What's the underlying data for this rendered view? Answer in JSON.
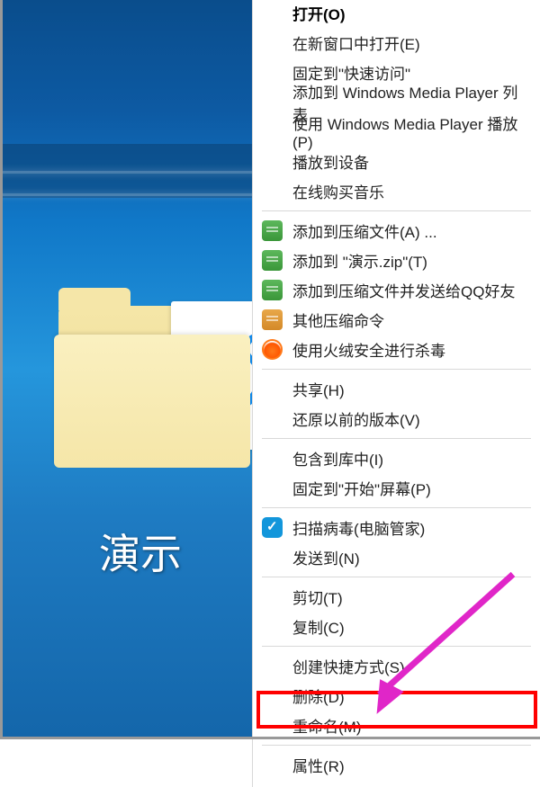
{
  "folder": {
    "label": "演示"
  },
  "context_menu": {
    "sections": [
      [
        {
          "label": "打开(O)",
          "bold": true,
          "icon": null
        },
        {
          "label": "在新窗口中打开(E)",
          "icon": null
        },
        {
          "label": "固定到\"快速访问\"",
          "icon": null
        },
        {
          "label": "添加到 Windows Media Player 列表",
          "icon": null
        },
        {
          "label": "使用 Windows Media Player 播放(P)",
          "icon": null
        },
        {
          "label": "播放到设备",
          "icon": null
        },
        {
          "label": "在线购买音乐",
          "icon": null
        }
      ],
      [
        {
          "label": "添加到压缩文件(A) ...",
          "icon": "archive-green"
        },
        {
          "label": "添加到 \"演示.zip\"(T)",
          "icon": "archive-green"
        },
        {
          "label": "添加到压缩文件并发送给QQ好友",
          "icon": "archive-green"
        },
        {
          "label": "其他压缩命令",
          "icon": "archive-orange"
        },
        {
          "label": "使用火绒安全进行杀毒",
          "icon": "fire"
        }
      ],
      [
        {
          "label": "共享(H)",
          "icon": null
        },
        {
          "label": "还原以前的版本(V)",
          "icon": null
        }
      ],
      [
        {
          "label": "包含到库中(I)",
          "icon": null
        },
        {
          "label": "固定到\"开始\"屏幕(P)",
          "icon": null
        }
      ],
      [
        {
          "label": "扫描病毒(电脑管家)",
          "icon": "shield"
        },
        {
          "label": "发送到(N)",
          "icon": null
        }
      ],
      [
        {
          "label": "剪切(T)",
          "icon": null
        },
        {
          "label": "复制(C)",
          "icon": null
        }
      ],
      [
        {
          "label": "创建快捷方式(S)",
          "icon": null
        },
        {
          "label": "删除(D)",
          "icon": null
        },
        {
          "label": "重命名(M)",
          "icon": null
        }
      ],
      [
        {
          "label": "属性(R)",
          "icon": null
        }
      ]
    ]
  }
}
